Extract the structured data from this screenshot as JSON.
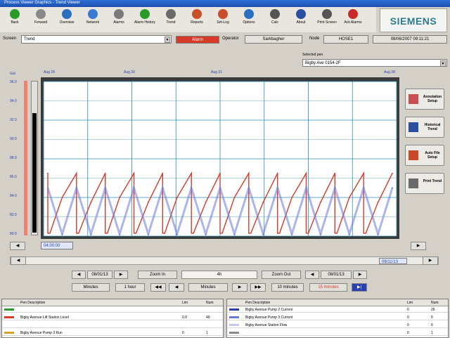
{
  "window": {
    "title": "Process Viewer Graphics - Trend Viewer"
  },
  "toolbar": {
    "buttons": [
      {
        "label": "Back",
        "icon": "back-arrow-icon",
        "color": "#2a9a2a"
      },
      {
        "label": "Forward",
        "icon": "forward-arrow-icon",
        "color": "#8a8a8a"
      },
      {
        "label": "Overview",
        "icon": "globe-icon",
        "color": "#2a6fc0"
      },
      {
        "label": "Network",
        "icon": "network-icon",
        "color": "#3a7ad0"
      },
      {
        "label": "Alarms",
        "icon": "alarm-bell-icon",
        "color": "#7a7a7a"
      },
      {
        "label": "Alarm History",
        "icon": "alarm-history-icon",
        "color": "#2a9a2a"
      },
      {
        "label": "Trend",
        "icon": "trend-icon",
        "color": "#6a6a6a"
      },
      {
        "label": "Reports",
        "icon": "reports-icon",
        "color": "#c8502a"
      },
      {
        "label": "Set-Log",
        "icon": "setlog-icon",
        "color": "#c8502a"
      },
      {
        "label": "Options",
        "icon": "options-icon",
        "color": "#2a6fc0"
      },
      {
        "label": "Calc",
        "icon": "calc-icon",
        "color": "#555555"
      },
      {
        "label": "About",
        "icon": "info-icon",
        "color": "#2a4fa0"
      },
      {
        "label": "Print Screen",
        "icon": "printer-icon",
        "color": "#555555"
      },
      {
        "label": "Ack Alarms",
        "icon": "ack-alarm-icon",
        "color": "#c82a2a"
      }
    ]
  },
  "brand": {
    "logo_text": "SIEMENS"
  },
  "fields": {
    "screen_label": "Screen",
    "screen_value": "Trend",
    "status_value": "Alarm",
    "operator_label": "Operator",
    "operator_value": "Sarkbagher",
    "node_label": "Node",
    "node_value": "HOSE1",
    "datetime_value": "08/06/2007 09:11:21"
  },
  "trend": {
    "selected_label": "Selected pen",
    "selected_value": "Bigby Ave 0154-2F",
    "y_unit": "Gal",
    "y_ticks": [
      "96.0",
      "94.0",
      "92.0",
      "90.0",
      "88.0",
      "86.0",
      "84.0",
      "82.0",
      "80.0"
    ],
    "x_dates": [
      "Aug 28",
      "Aug 30",
      "Aug 31",
      "Aug 28"
    ],
    "left_time": "04:00:00",
    "right_time": "08/11/13"
  },
  "side_buttons": [
    {
      "label": "Annotation Setup",
      "icon": "annotation-icon",
      "color": "#c85050"
    },
    {
      "label": "Historical Trend",
      "icon": "historical-trend-icon",
      "color": "#2a4fa0"
    },
    {
      "label": "Auto File Setup",
      "icon": "auto-file-icon",
      "color": "#c84a2a"
    },
    {
      "label": "Print Trend",
      "icon": "print-trend-icon",
      "color": "#6a6a6a"
    }
  ],
  "nav": {
    "start_date": "08/01/13",
    "zoom_in": "Zoom In",
    "hours": "4h",
    "zoom_out": "Zoom Out",
    "end_date": "08/01/13",
    "minutes_btn": "Minutes",
    "one_hour": "1 hour",
    "minutes_mode": "Minutes",
    "ten_minutes": "10 minutes",
    "fifteen_minutes": "15 minutes"
  },
  "tables": {
    "left": {
      "headers": [
        "Pen Description",
        "Lim",
        "Num"
      ],
      "rows": [
        {
          "color": "#2a9a2a",
          "desc": "",
          "lim": "",
          "num": ""
        },
        {
          "color": "#d83a2a",
          "desc": "Bigby Avenue Lift Station Level",
          "lim": "0.0",
          "num": "49"
        },
        {
          "color": "#ffffff",
          "desc": "",
          "lim": "",
          "num": ""
        },
        {
          "color": "#d8a02a",
          "desc": "Bigby Avenue Pump 3 Run",
          "lim": "0",
          "num": "1"
        }
      ]
    },
    "right": {
      "headers": [
        "Pen Description",
        "Lim",
        "Num"
      ],
      "rows": [
        {
          "color": "#2a3fb0",
          "desc": "Bigby Avenue Pump 2 Current",
          "lim": "0",
          "num": "26"
        },
        {
          "color": "#6a7ad8",
          "desc": "Bigby Avenue Pump 3 Current",
          "lim": "0",
          "num": "0"
        },
        {
          "color": "#c8c8e8",
          "desc": "Bigby Avenue Station Flow",
          "lim": "0",
          "num": "0"
        },
        {
          "color": "#8a8a8a",
          "desc": "",
          "lim": "0",
          "num": "1"
        }
      ]
    }
  },
  "chart_data": {
    "type": "line",
    "title": "",
    "xlabel": "",
    "ylabel": "Gal",
    "ylim": [
      80,
      96
    ],
    "grid": true,
    "series": [
      {
        "name": "Bigby Avenue Lift Station Level",
        "color": "#d83a2a",
        "values": [
          86.5,
          84.0,
          86.5,
          83.5,
          86.5,
          84.0,
          86.5,
          83.5,
          86.5,
          84.0,
          86.5,
          83.5,
          86.5,
          84.0,
          86.5,
          83.5,
          86.5,
          84.0,
          86.5,
          83.5,
          86.5,
          84.0,
          86.5,
          83.5,
          86.5
        ]
      },
      {
        "name": "Bigby Avenue Pump 2 Current",
        "color": "#6a7ad8",
        "values": [
          85.0,
          80.2,
          85.0,
          80.2,
          85.0,
          80.2,
          85.0,
          80.2,
          85.0,
          80.2,
          85.0,
          80.2,
          85.0,
          80.2,
          85.0,
          80.2,
          85.0,
          80.2,
          85.0,
          80.2,
          85.0,
          80.2,
          85.0,
          80.2,
          85.0
        ]
      }
    ]
  }
}
